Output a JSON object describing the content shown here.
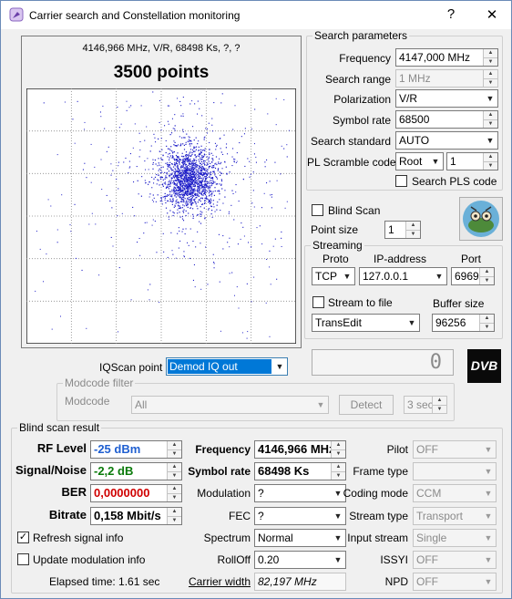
{
  "window": {
    "title": "Carrier search and Constellation monitoring",
    "help_glyph": "?",
    "close_glyph": "✕"
  },
  "constellation": {
    "info_line": "4146,966 MHz, V/R, 68498 Ks, ?, ?",
    "points_label": "3500 points"
  },
  "search_params": {
    "caption": "Search parameters",
    "frequency_label": "Frequency",
    "frequency_value": "4147,000 MHz",
    "search_range_label": "Search range",
    "search_range_value": "1 MHz",
    "polarization_label": "Polarization",
    "polarization_value": "V/R",
    "symbol_rate_label": "Symbol rate",
    "symbol_rate_value": "68500",
    "search_standard_label": "Search standard",
    "search_standard_value": "AUTO",
    "pl_scramble_label": "PL Scramble code",
    "pl_scramble_mode": "Root",
    "pl_scramble_value": "1",
    "search_pls_label": "Search PLS code"
  },
  "blind": {
    "blind_scan_label": "Blind Scan",
    "point_size_label": "Point size",
    "point_size_value": "1"
  },
  "streaming": {
    "caption": "Streaming",
    "proto_label": "Proto",
    "ip_label": "IP-address",
    "port_label": "Port",
    "proto_value": "TCP",
    "ip_value": "127.0.0.1",
    "port_value": "6969",
    "stream_to_file_label": "Stream to file",
    "buffer_size_label": "Buffer size",
    "format_value": "TransEdit",
    "buffer_size_value": "96256"
  },
  "iqscan": {
    "label": "IQScan point",
    "value": "Demod IQ out",
    "counter": "0"
  },
  "modcode_filter": {
    "caption": "Modcode filter",
    "modcode_label": "Modcode",
    "modcode_value": "All",
    "detect_label": "Detect",
    "timeout_value": "3 sec"
  },
  "dvb_logo": "DVB",
  "result": {
    "caption": "Blind scan result",
    "rf_level_label": "RF Level",
    "rf_level_value": "-25 dBm",
    "snr_label": "Signal/Noise",
    "snr_value": "-2,2 dB",
    "ber_label": "BER",
    "ber_value": "0,0000000",
    "bitrate_label": "Bitrate",
    "bitrate_value": "0,158 Mbit/s",
    "refresh_label": "Refresh signal info",
    "update_mod_label": "Update modulation info",
    "elapsed": "Elapsed time: 1.61 sec",
    "frequency_label": "Frequency",
    "frequency_value": "4146,966 MHz",
    "symbol_rate_label": "Symbol rate",
    "symbol_rate_value": "68498 Ks",
    "modulation_label": "Modulation",
    "modulation_value": "?",
    "fec_label": "FEC",
    "fec_value": "?",
    "spectrum_label": "Spectrum",
    "spectrum_value": "Normal",
    "rolloff_label": "RollOff",
    "rolloff_value": "0.20",
    "carrier_width_label": "Carrier width",
    "carrier_width_value": "82,197 MHz",
    "pilot_label": "Pilot",
    "pilot_value": "OFF",
    "frame_type_label": "Frame type",
    "frame_type_value": "",
    "coding_mode_label": "Coding mode",
    "coding_mode_value": "CCM",
    "stream_type_label": "Stream type",
    "stream_type_value": "Transport",
    "input_stream_label": "Input stream",
    "input_stream_value": "Single",
    "issyi_label": "ISSYI",
    "issyi_value": "OFF",
    "npd_label": "NPD",
    "npd_value": "OFF"
  },
  "colors": {
    "points": "#1e1ec8",
    "rf_level": "#1f5fd0",
    "snr": "#0a7a0a",
    "ber": "#d00000"
  }
}
